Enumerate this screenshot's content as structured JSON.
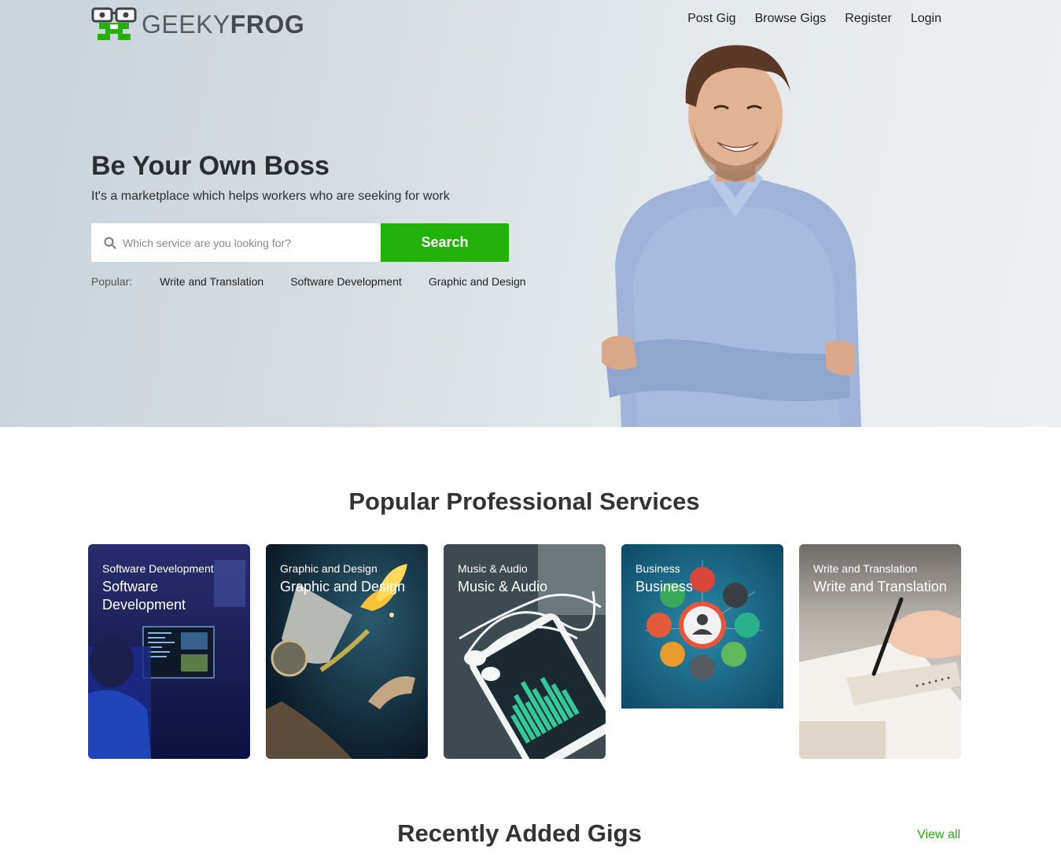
{
  "brand": {
    "name_light": "GEEKY",
    "name_bold": "FROG",
    "color": "#23b20a"
  },
  "nav": {
    "items": [
      {
        "label": "Post Gig"
      },
      {
        "label": "Browse Gigs"
      },
      {
        "label": "Register"
      },
      {
        "label": "Login"
      }
    ]
  },
  "hero": {
    "title": "Be Your Own Boss",
    "subtitle": "It's a marketplace which helps workers who are seeking for work",
    "search": {
      "placeholder": "Which service are you looking for?",
      "value": "",
      "button_label": "Search",
      "icon": "search-icon"
    },
    "popular": {
      "label": "Popular:",
      "links": [
        "Write and Translation",
        "Software Development",
        "Graphic and Design"
      ]
    }
  },
  "services": {
    "title": "Popular Professional Services",
    "cards": [
      {
        "category": "Software Development",
        "title": "Software Development"
      },
      {
        "category": "Graphic and Design",
        "title": "Graphic and Design"
      },
      {
        "category": "Music & Audio",
        "title": "Music & Audio"
      },
      {
        "category": "Business",
        "title": "Business"
      },
      {
        "category": "Write and Translation",
        "title": "Write and Translation"
      }
    ]
  },
  "recent": {
    "title": "Recently Added Gigs",
    "view_all": "View all"
  },
  "colors": {
    "accent": "#23b20a",
    "hero_bg": "#d6dde2",
    "text_dark": "#2a2d31"
  }
}
